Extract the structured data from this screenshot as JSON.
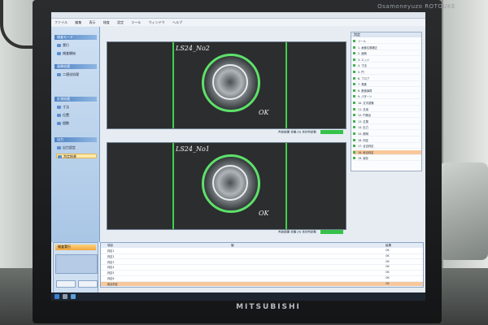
{
  "monitor": {
    "top_brand": "Osamoneyuzo ROTOUKE",
    "bottom_brand": "MITSUBISHI"
  },
  "app": {
    "menu": [
      "ファイル",
      "編集",
      "表示",
      "検査",
      "設定",
      "ツール",
      "ウィンドウ",
      "ヘルプ"
    ],
    "sidebar": {
      "sections": [
        {
          "title": "検査モード",
          "items": [
            "実行",
            "検査開始"
          ]
        },
        {
          "title": "画像処理",
          "items": [
            "二値化処理"
          ]
        },
        {
          "title": "計測処理",
          "items": [
            "寸法",
            "位置",
            "個数"
          ]
        },
        {
          "title": "出力",
          "items": [
            "出力設定",
            "判定結果"
          ]
        }
      ]
    },
    "views": [
      {
        "label": "LS24_No2",
        "result": "OK",
        "status": "判定結果 合格 (0) 合計判定数",
        "status_value": "OK"
      },
      {
        "label": "LS24_No1",
        "result": "OK",
        "status": "判定結果 合格 (0) 合計判定数",
        "status_value": "OK"
      }
    ],
    "panel": {
      "title": "判定",
      "rows": [
        {
          "name": "ツール",
          "value": "",
          "highlight": false
        },
        {
          "name": "1. 画像位置補正",
          "value": "",
          "highlight": false
        },
        {
          "name": "2. 面積",
          "value": "",
          "highlight": false
        },
        {
          "name": "3. エッジ",
          "value": "",
          "highlight": false
        },
        {
          "name": "4. 寸法",
          "value": "",
          "highlight": false
        },
        {
          "name": "5. 円",
          "value": "",
          "highlight": false
        },
        {
          "name": "6. ブロブ",
          "value": "",
          "highlight": false
        },
        {
          "name": "7. 角度",
          "value": "",
          "highlight": false
        },
        {
          "name": "8. 数値演算",
          "value": "",
          "highlight": false
        },
        {
          "name": "9. パターン",
          "value": "",
          "highlight": false
        },
        {
          "name": "10. 文字認識",
          "value": "",
          "highlight": false
        },
        {
          "name": "11. 汎用",
          "value": "",
          "highlight": false
        },
        {
          "name": "12. 円検出",
          "value": "",
          "highlight": false
        },
        {
          "name": "13. 位置",
          "value": "",
          "highlight": false
        },
        {
          "name": "14. 出力",
          "value": "",
          "highlight": false
        },
        {
          "name": "15. 照明",
          "value": "",
          "highlight": false
        },
        {
          "name": "16. 判定",
          "value": "",
          "highlight": false
        },
        {
          "name": "17. 合否判定",
          "value": "",
          "highlight": false
        },
        {
          "name": "18. 総合判定",
          "value": "",
          "highlight": true
        },
        {
          "name": "19. 保存",
          "value": "",
          "highlight": false
        }
      ]
    },
    "bottom_left": {
      "run_button": "検査実行",
      "btn_a": "",
      "btn_b": ""
    },
    "grid": {
      "headers": [
        "",
        "項目",
        "値",
        "結果"
      ],
      "rows": [
        {
          "name": "判定1",
          "value": "",
          "result": "OK",
          "selected": false
        },
        {
          "name": "判定2",
          "value": "",
          "result": "OK",
          "selected": false
        },
        {
          "name": "判定3",
          "value": "",
          "result": "OK",
          "selected": false
        },
        {
          "name": "判定4",
          "value": "",
          "result": "OK",
          "selected": false
        },
        {
          "name": "判定5",
          "value": "",
          "result": "OK",
          "selected": false
        },
        {
          "name": "判定6",
          "value": "",
          "result": "OK",
          "selected": false
        },
        {
          "name": "総合判定",
          "value": "",
          "result": "OK",
          "selected": true
        }
      ]
    },
    "taskbar": {
      "time": ""
    }
  },
  "colors": {
    "roi_line": "#3ed24c",
    "ok_status": "#36c24a",
    "highlight_row": "#f6c89c"
  }
}
